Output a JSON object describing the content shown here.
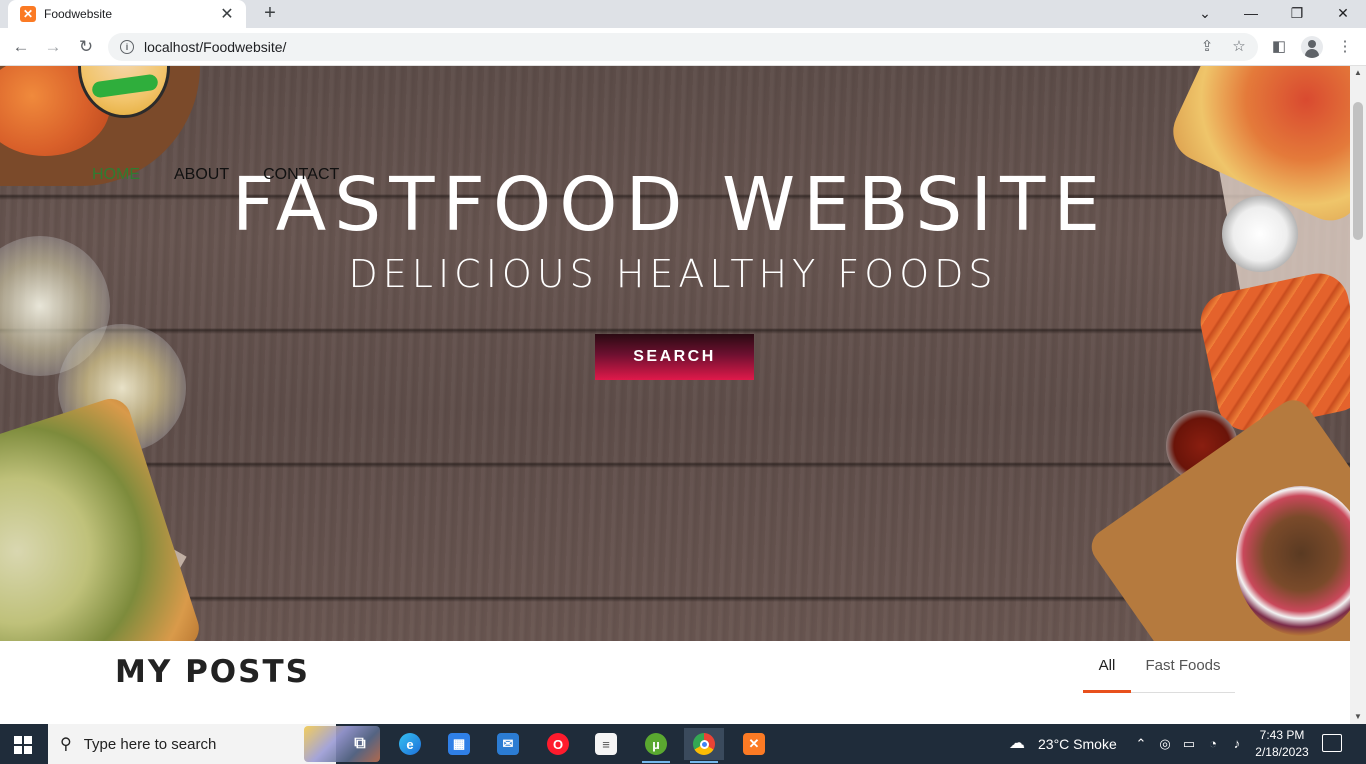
{
  "browser": {
    "tab_title": "Foodwebsite",
    "tab_favicon": "xampp-favicon",
    "url": "localhost/Foodwebsite/",
    "new_tab": "+",
    "close_tab": "✕"
  },
  "site": {
    "nav": [
      {
        "label": "HOME",
        "active": true
      },
      {
        "label": "ABOUT",
        "active": false
      },
      {
        "label": "CONTACT",
        "active": false
      }
    ],
    "hero_title": "FASTFOOD WEBSITE",
    "hero_subtitle": "DELICIOUS HEALTHY FOODS",
    "hero_button": "SEARCH",
    "posts_heading": "MY POSTS",
    "filters": [
      {
        "label": "All",
        "active": true
      },
      {
        "label": "Fast Foods",
        "active": false
      }
    ]
  },
  "taskbar": {
    "search_placeholder": "Type here to search",
    "weather": "23°C  Smoke",
    "time": "7:43 PM",
    "date": "2/18/2023"
  },
  "colors": {
    "nav_active": "#2e7d32",
    "accent": "#e8501c",
    "button": "#e0194a"
  }
}
